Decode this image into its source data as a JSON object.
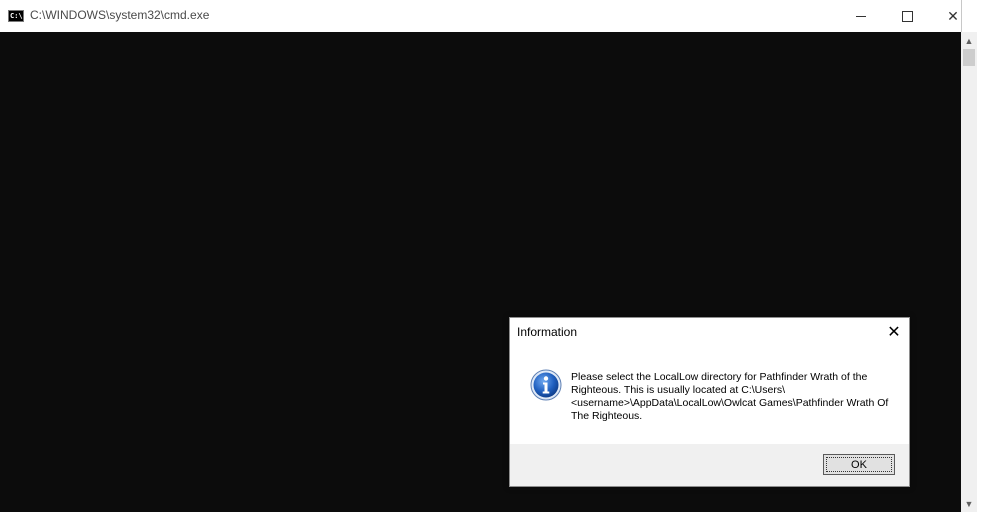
{
  "window": {
    "title": "C:\\WINDOWS\\system32\\cmd.exe",
    "icon": "cmd-icon",
    "controls": {
      "minimize": "minimize-icon",
      "maximize": "maximize-icon",
      "close": "✕"
    }
  },
  "scrollbar": {
    "up": "▲",
    "down": "▼"
  },
  "dialog": {
    "title": "Information",
    "close": "✕",
    "icon": "info-icon",
    "message": "Please select the LocalLow directory for Pathfinder Wrath of the Righteous. This is usually located at C:\\Users\\<username>\\AppData\\LocalLow\\Owlcat Games\\Pathfinder Wrath Of The Righteous.",
    "ok_label": "OK"
  },
  "colors": {
    "console_bg": "#0c0c0c",
    "dialog_footer": "#f0f0f0",
    "info_blue": "#1f5fbf"
  }
}
